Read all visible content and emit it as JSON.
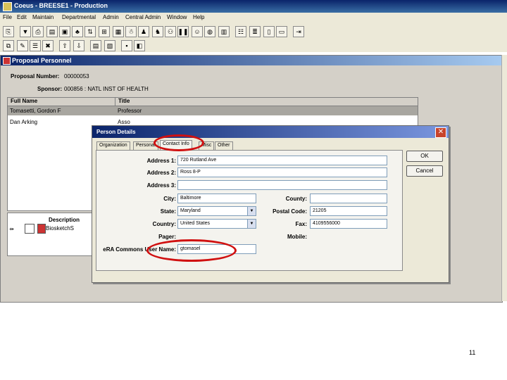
{
  "app": {
    "title": "Coeus - BREESE1 - Production"
  },
  "menu": [
    "File",
    "Edit",
    "Maintain",
    "Departmental",
    "Admin",
    "Central Admin",
    "Window",
    "Help"
  ],
  "toolbar1_icons": [
    "open-icon",
    "filter-icon",
    "print-icon",
    "save-icon",
    "folder-icon",
    "people-icon",
    "arrows-icon",
    "tree-icon",
    "grid-icon",
    "person-icon",
    "pause-icon",
    "face-icon",
    "globe-icon",
    "money-icon",
    "report-icon",
    "columns-icon",
    "window-icon",
    "export-icon"
  ],
  "toolbar2_icons": [
    "copy-icon",
    "edit-icon",
    "delete-icon",
    "up-icon",
    "down-icon",
    "sheet-icon",
    "pdf-icon",
    "save-disk-icon",
    "close-doc-icon"
  ],
  "proposal_window": {
    "title": "Proposal Personnel",
    "proposal_number_label": "Proposal Number:",
    "proposal_number": "00000053",
    "sponsor_label": "Sponsor:",
    "sponsor": "000856 : NATL INST OF HEALTH",
    "columns": [
      "Full Name",
      "Title"
    ],
    "rows": [
      {
        "name": "Tomasetti, Gordon F",
        "title": "Professor"
      },
      {
        "name": "Dan Arking",
        "title": "Asso"
      }
    ],
    "desc_header": "Description",
    "desc_item": "BiosketchS"
  },
  "dialog": {
    "title": "Person Details",
    "tabs": [
      "Organization",
      "Personal",
      "Contact Info",
      "Misc",
      "Other"
    ],
    "active_tab": "Contact Info",
    "ok_label": "OK",
    "cancel_label": "Cancel",
    "fields": {
      "address1_label": "Address 1:",
      "address1": "720 Rutland Ave",
      "address2_label": "Address 2:",
      "address2": "Ross 8-P",
      "address3_label": "Address 3:",
      "address3": "",
      "city_label": "City:",
      "city": "Baltimore",
      "county_label": "County:",
      "county": "",
      "state_label": "State:",
      "state": "Maryland",
      "postal_label": "Postal Code:",
      "postal": "21205",
      "country_label": "Country:",
      "country": "United States",
      "fax_label": "Fax:",
      "fax": "4109556000",
      "pager_label": "Pager:",
      "mobile_label": "Mobile:",
      "era_label": "eRA Commons User Name:",
      "era": "gtomasel"
    }
  },
  "highlight_color": "#d01010",
  "page_number": "11"
}
